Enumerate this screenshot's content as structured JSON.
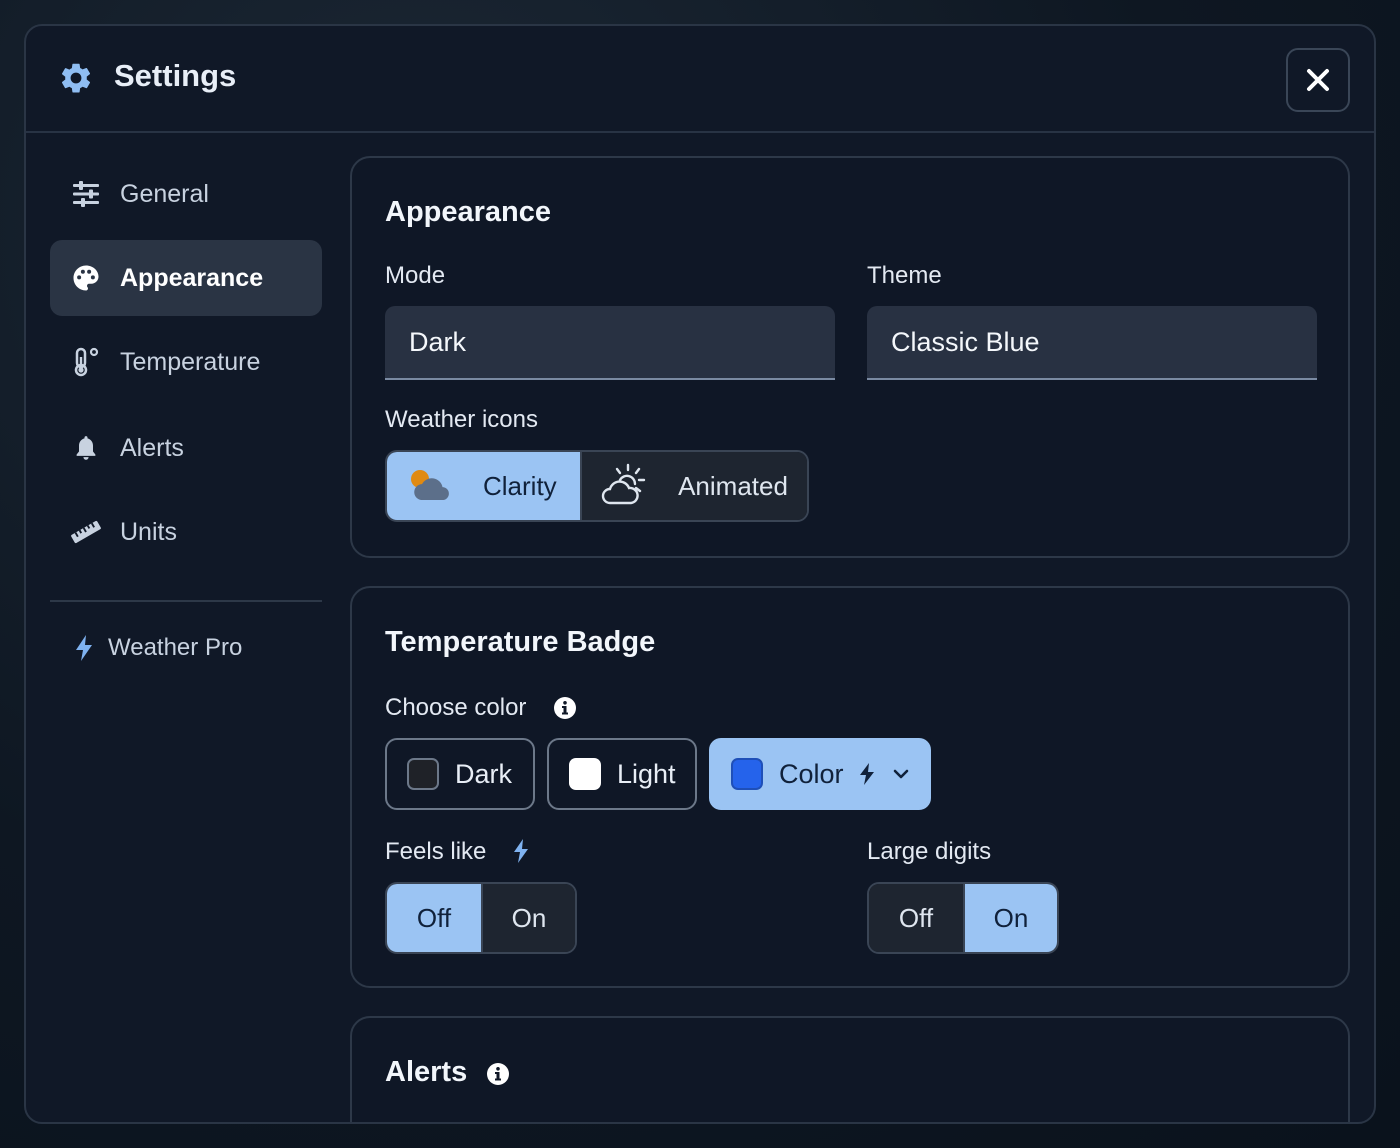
{
  "dialog": {
    "title": "Settings",
    "icon": "gear-icon",
    "close_icon": "close-icon"
  },
  "sidebar": {
    "items": [
      {
        "label": "General",
        "icon": "sliders-icon",
        "active": false
      },
      {
        "label": "Appearance",
        "icon": "palette-icon",
        "active": true
      },
      {
        "label": "Temperature",
        "icon": "thermometer-icon",
        "active": false
      },
      {
        "label": "Alerts",
        "icon": "bell-icon",
        "active": false
      },
      {
        "label": "Units",
        "icon": "ruler-icon",
        "active": false
      }
    ],
    "pro": {
      "label": "Weather Pro",
      "icon": "bolt-icon"
    }
  },
  "appearance": {
    "title": "Appearance",
    "mode": {
      "label": "Mode",
      "value": "Dark"
    },
    "theme": {
      "label": "Theme",
      "value": "Classic Blue"
    },
    "weather_icons": {
      "label": "Weather icons",
      "options": [
        {
          "label": "Clarity",
          "icon": "partly-cloudy-icon",
          "selected": true
        },
        {
          "label": "Animated",
          "icon": "sun-cloud-outline-icon",
          "selected": false
        }
      ]
    }
  },
  "temperature_badge": {
    "title": "Temperature Badge",
    "choose_color": {
      "label": "Choose color",
      "options": [
        {
          "label": "Dark",
          "swatch": "#1f2228",
          "selected": false
        },
        {
          "label": "Light",
          "swatch": "#ffffff",
          "selected": false
        },
        {
          "label": "Color",
          "swatch": "#2563eb",
          "selected": true
        }
      ]
    },
    "feels_like": {
      "label": "Feels like",
      "off": "Off",
      "on": "On",
      "value": "Off"
    },
    "large_digits": {
      "label": "Large digits",
      "off": "Off",
      "on": "On",
      "value": "On"
    }
  },
  "alerts": {
    "title": "Alerts"
  },
  "colors": {
    "accent": "#9bc4f3",
    "panel": "#101827",
    "bolt": "#7fb2f0"
  }
}
